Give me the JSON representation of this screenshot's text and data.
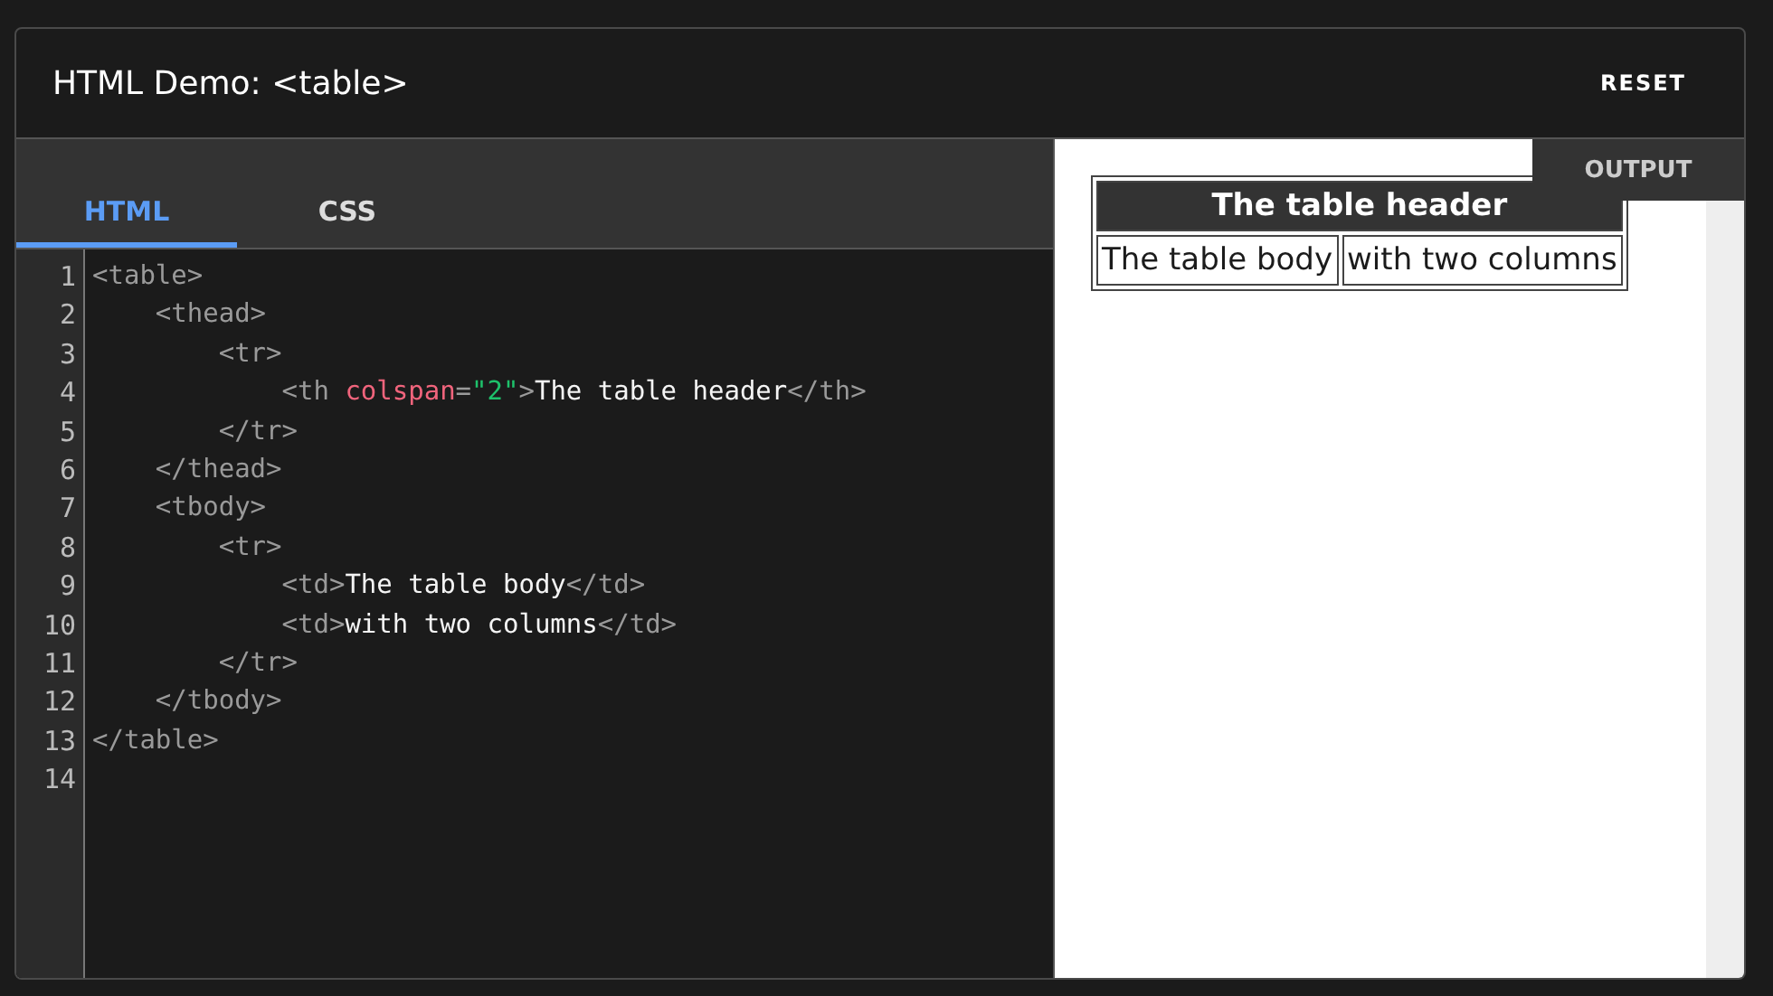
{
  "title": "HTML Demo: <table>",
  "reset_button": "RESET",
  "tabs": [
    {
      "label": "HTML",
      "selected": true
    },
    {
      "label": "CSS",
      "selected": false
    }
  ],
  "code_lines": [
    {
      "number": "1",
      "tokens": [
        {
          "kind": "tag",
          "text": "<table>"
        }
      ]
    },
    {
      "number": "2",
      "tokens": [
        {
          "kind": "tag",
          "text": "    <thead>"
        }
      ]
    },
    {
      "number": "3",
      "tokens": [
        {
          "kind": "tag",
          "text": "        <tr>"
        }
      ]
    },
    {
      "number": "4",
      "tokens": [
        {
          "kind": "tag",
          "text": "            <th "
        },
        {
          "kind": "attr",
          "text": "colspan"
        },
        {
          "kind": "tag",
          "text": "="
        },
        {
          "kind": "value",
          "text": "\"2\""
        },
        {
          "kind": "tag",
          "text": ">"
        },
        {
          "kind": "text",
          "text": "The table header"
        },
        {
          "kind": "tag",
          "text": "</th>"
        }
      ]
    },
    {
      "number": "5",
      "tokens": [
        {
          "kind": "tag",
          "text": "        </tr>"
        }
      ]
    },
    {
      "number": "6",
      "tokens": [
        {
          "kind": "tag",
          "text": "    </thead>"
        }
      ]
    },
    {
      "number": "7",
      "tokens": [
        {
          "kind": "tag",
          "text": "    <tbody>"
        }
      ]
    },
    {
      "number": "8",
      "tokens": [
        {
          "kind": "tag",
          "text": "        <tr>"
        }
      ]
    },
    {
      "number": "9",
      "tokens": [
        {
          "kind": "tag",
          "text": "            <td>"
        },
        {
          "kind": "text",
          "text": "The table body"
        },
        {
          "kind": "tag",
          "text": "</td>"
        }
      ]
    },
    {
      "number": "10",
      "tokens": [
        {
          "kind": "tag",
          "text": "            <td>"
        },
        {
          "kind": "text",
          "text": "with two columns"
        },
        {
          "kind": "tag",
          "text": "</td>"
        }
      ]
    },
    {
      "number": "11",
      "tokens": [
        {
          "kind": "tag",
          "text": "        </tr>"
        }
      ]
    },
    {
      "number": "12",
      "tokens": [
        {
          "kind": "tag",
          "text": "    </tbody>"
        }
      ]
    },
    {
      "number": "13",
      "tokens": [
        {
          "kind": "tag",
          "text": "</table>"
        }
      ]
    },
    {
      "number": "14"
    }
  ],
  "output": {
    "tab": "OUTPUT",
    "table_header": "The table header",
    "table_body": [
      "The table body",
      "with two columns"
    ]
  }
}
